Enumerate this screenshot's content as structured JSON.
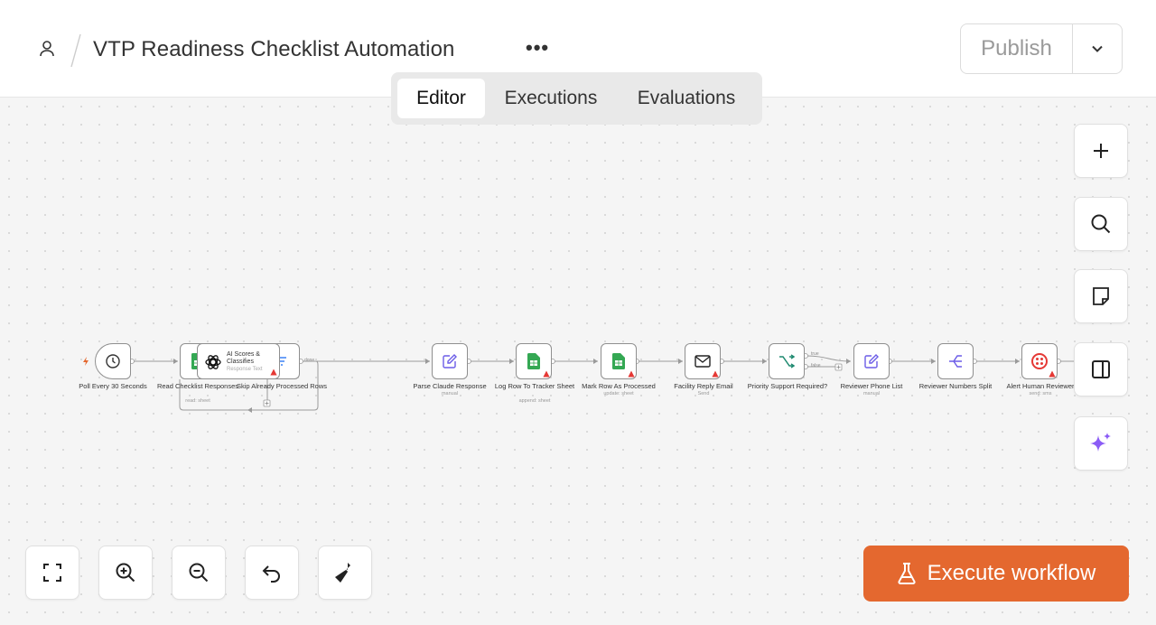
{
  "header": {
    "title": "VTP Readiness Checklist Automation",
    "more_label": "•••",
    "publish_label": "Publish"
  },
  "tabs": [
    {
      "label": "Editor",
      "active": true
    },
    {
      "label": "Executions",
      "active": false
    },
    {
      "label": "Evaluations",
      "active": false
    }
  ],
  "nodes": [
    {
      "label": "Poll Every 30 Seconds",
      "sub": "",
      "icon": "clock-icon"
    },
    {
      "label": "Read Checklist Responses",
      "sub": "read: sheet",
      "icon": "google-sheets-icon"
    },
    {
      "label": "Skip Already Processed Rows",
      "sub": "",
      "icon": "filter-icon"
    },
    {
      "label": "Parse Claude Response",
      "sub": "manual",
      "icon": "edit-icon"
    },
    {
      "label": "Log Row To Tracker Sheet",
      "sub": "append: sheet",
      "icon": "google-sheets-icon"
    },
    {
      "label": "Mark Row As Processed",
      "sub": "update: sheet",
      "icon": "google-sheets-icon"
    },
    {
      "label": "Facility Reply Email",
      "sub": "Send",
      "icon": "mail-icon"
    },
    {
      "label": "Priority Support Required?",
      "sub": "",
      "icon": "switch-icon"
    },
    {
      "label": "Reviewer Phone List",
      "sub": "manual",
      "icon": "edit-icon"
    },
    {
      "label": "Reviewer Numbers Split",
      "sub": "",
      "icon": "split-icon"
    },
    {
      "label": "Alert Human Reviewer",
      "sub": "send: sms",
      "icon": "twilio-icon"
    }
  ],
  "ai_node": {
    "title": "AI Scores & Classifies",
    "sub": "Response Text",
    "icon": "openai-icon"
  },
  "edge_labels": {
    "done": "done",
    "true": "true",
    "false": "false"
  },
  "execute": {
    "label": "Execute workflow"
  },
  "colors": {
    "accent": "#e4682f",
    "sheets_green": "#34a853",
    "edit_purple": "#6b5ce7",
    "warning_red": "#e53935",
    "twilio_red": "#e53935",
    "sparkle_purple": "#8b5cf6"
  }
}
